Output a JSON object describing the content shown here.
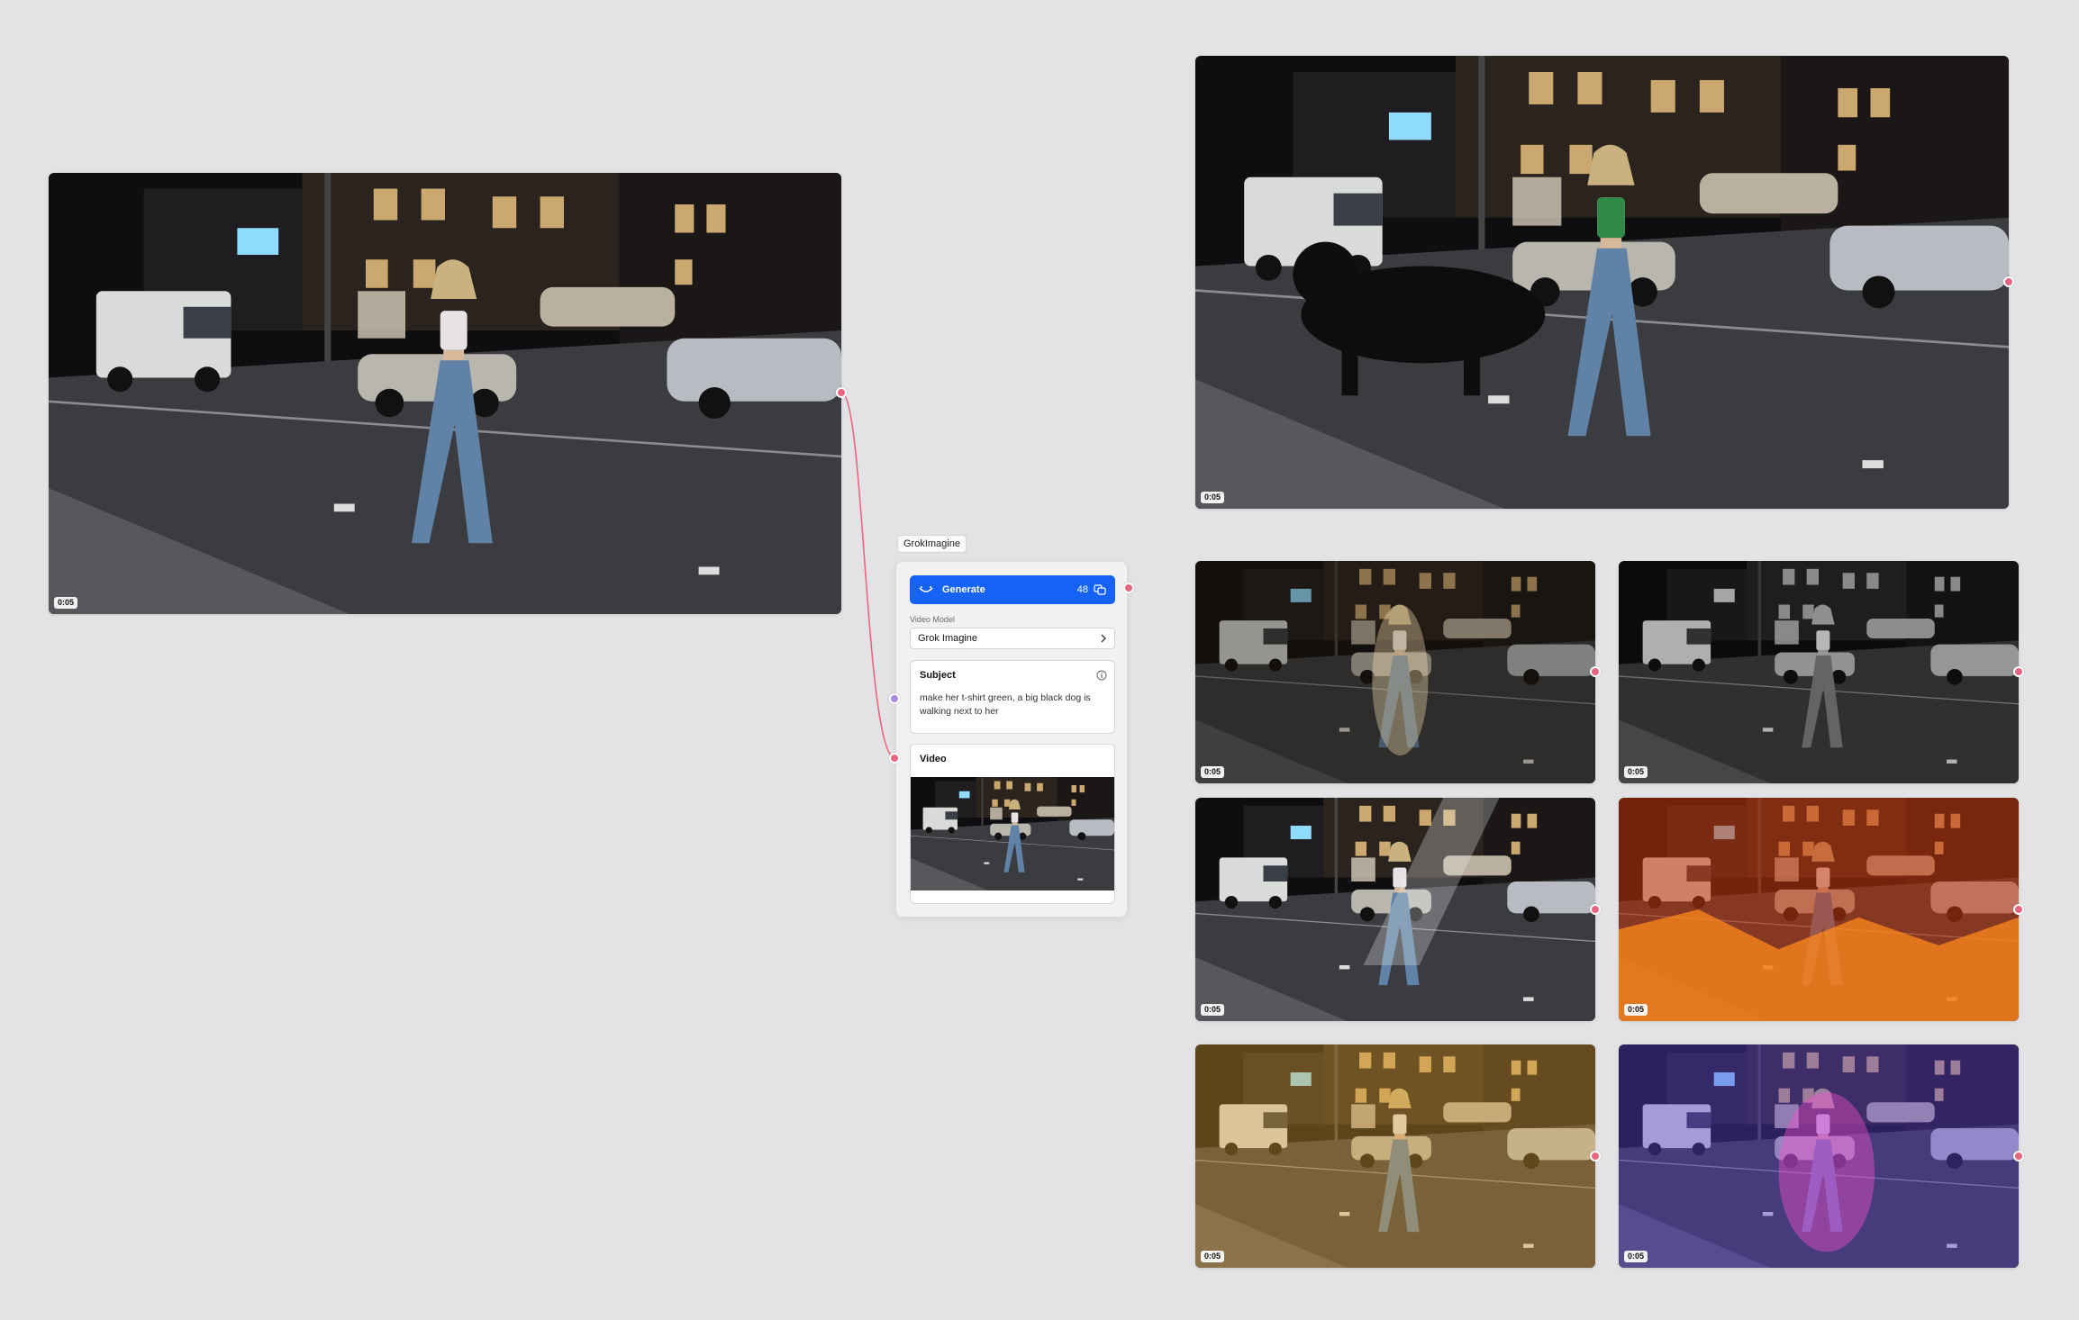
{
  "source_node": {
    "duration": "0:05"
  },
  "output_main": {
    "duration": "0:05"
  },
  "outputs": [
    {
      "duration": "0:05",
      "variant": "backlit"
    },
    {
      "duration": "0:05",
      "variant": "grayscale"
    },
    {
      "duration": "0:05",
      "variant": "light-beam"
    },
    {
      "duration": "0:05",
      "variant": "fire"
    },
    {
      "duration": "0:05",
      "variant": "golden"
    },
    {
      "duration": "0:05",
      "variant": "neon-pink"
    }
  ],
  "grok_node": {
    "tag": "GrokImagine",
    "generate_label": "Generate",
    "credits": "48",
    "video_model_label": "Video Model",
    "video_model_value": "Grok Imagine",
    "subject_title": "Subject",
    "subject_text": "make her t-shirt green, a big black dog is walking next to her",
    "video_title": "Video"
  },
  "colors": {
    "canvas_bg": "#e3e3e5",
    "accent": "#1562f5",
    "port_pink": "#e8677e",
    "port_purple": "#a98be0",
    "edge": "#e8677e"
  },
  "icons": [
    "grok-logo-icon",
    "credits-icon",
    "chevron-right-icon",
    "info-icon"
  ]
}
